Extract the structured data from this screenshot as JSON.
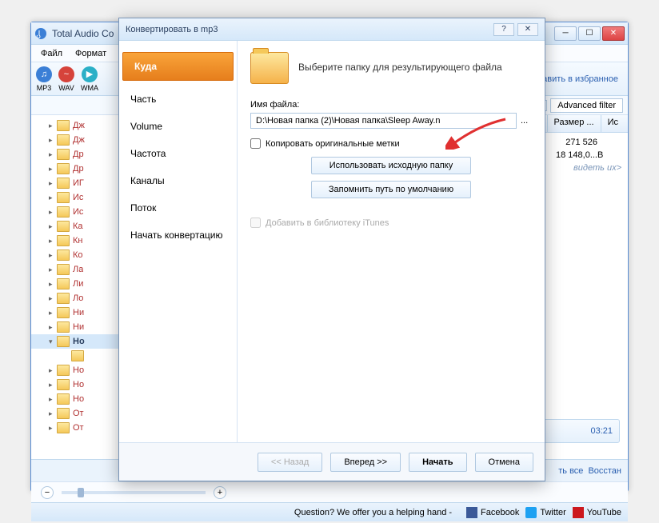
{
  "main": {
    "title": "Total Audio Co",
    "menu": {
      "file": "Файл",
      "format": "Формат"
    },
    "formats": [
      {
        "label": "MP3",
        "color": "blue",
        "glyph": "♫"
      },
      {
        "label": "WAV",
        "color": "red",
        "glyph": "~"
      },
      {
        "label": "WMA",
        "color": "teal",
        "glyph": "▶"
      }
    ],
    "fav_link": "авить в избранное",
    "advanced_filter": "Advanced filter",
    "columns": {
      "size": "Размер ...",
      "ext": "Ис"
    },
    "rows": [
      {
        "size": "271 526",
        "ext": ""
      },
      {
        "size": "18 148,0...",
        "ext": "В"
      }
    ],
    "hint": "видеть их>",
    "footer_links": {
      "all": "ть все",
      "restore": "Восстан"
    },
    "player_time": "03:21",
    "question": "Question? We offer you a helping hand  -",
    "social": {
      "fb": "Facebook",
      "tw": "Twitter",
      "yt": "YouTube"
    }
  },
  "tree": {
    "items": [
      {
        "label": "Дж",
        "arr": "▸"
      },
      {
        "label": "Дж",
        "arr": "▸"
      },
      {
        "label": "Др",
        "arr": "▸"
      },
      {
        "label": "Др",
        "arr": "▸"
      },
      {
        "label": "ИГ",
        "arr": "▸"
      },
      {
        "label": "Ис",
        "arr": "▸"
      },
      {
        "label": "Ис",
        "arr": "▸"
      },
      {
        "label": "Ка",
        "arr": "▸"
      },
      {
        "label": "Кн",
        "arr": "▸"
      },
      {
        "label": "Ко",
        "arr": "▸"
      },
      {
        "label": "Ла",
        "arr": "▸"
      },
      {
        "label": "Ли",
        "arr": "▸"
      },
      {
        "label": "Ло",
        "arr": "▸"
      },
      {
        "label": "Ни",
        "arr": "▸"
      },
      {
        "label": "Ни",
        "arr": "▸"
      },
      {
        "label": "Но",
        "arr": "▾",
        "sel": true
      },
      {
        "label": "",
        "sub": true
      },
      {
        "label": "Но",
        "arr": "▸"
      },
      {
        "label": "Но",
        "arr": "▸"
      },
      {
        "label": "Но",
        "arr": "▸"
      },
      {
        "label": "От",
        "arr": "▸"
      },
      {
        "label": "От",
        "arr": "▸"
      }
    ]
  },
  "dialog": {
    "title": "Конвертировать в mp3",
    "nav": [
      {
        "label": "Куда",
        "active": true
      },
      {
        "label": "Часть"
      },
      {
        "label": "Volume"
      },
      {
        "label": "Частота"
      },
      {
        "label": "Каналы"
      },
      {
        "label": "Поток"
      },
      {
        "label": "Начать конвертацию"
      }
    ],
    "header_text": "Выберите папку для результирующего файла",
    "file_label": "Имя файла:",
    "file_value": "D:\\Новая папка (2)\\Новая папка\\Sleep Away.n",
    "copy_tags": "Копировать оригинальные метки",
    "use_source": "Использовать исходную папку",
    "remember_path": "Запомнить путь по умолчанию",
    "add_itunes": "Добавить в библиотеку iTunes",
    "back": "<< Назад",
    "forward": "Вперед >>",
    "start": "Начать",
    "cancel": "Отмена"
  }
}
